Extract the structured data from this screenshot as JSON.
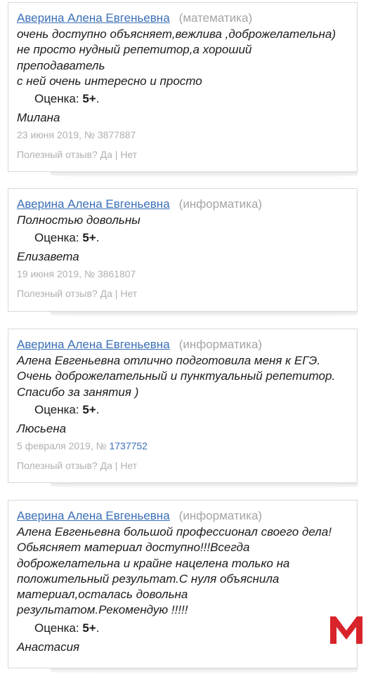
{
  "reviews": [
    {
      "tutor": "Аверина Алена Евгеньевна",
      "subject": "(математика)",
      "lines": [
        "очень доступно объясняет,вежлива ,доброжелательна)",
        "не просто нудный репетитор,а хороший",
        "преподаватель",
        "с ней очень интересно и просто"
      ],
      "rating_label": "Оценка:",
      "rating_value": "5+",
      "author": "Милана",
      "date_prefix": "23 июня 2019, №",
      "number": "3877887",
      "helpful_question": "Полезный отзыв?",
      "yes": "Да",
      "separator": "|",
      "no": "Нет"
    },
    {
      "tutor": "Аверина Алена Евгеньевна",
      "subject": "(информатика)",
      "lines": [
        "Полностью довольны"
      ],
      "rating_label": "Оценка:",
      "rating_value": "5+",
      "author": "Елизавета",
      "date_prefix": "19 июня 2019, №",
      "number": "3861807",
      "helpful_question": "Полезный отзыв?",
      "yes": "Да",
      "separator": "|",
      "no": "Нет"
    },
    {
      "tutor": "Аверина Алена Евгеньевна",
      "subject": "(информатика)",
      "lines": [
        "Алена Евгеньевна отлично подготовила меня к ЕГЭ.",
        "Очень доброжелательный и пунктуальный репетитор.",
        "Спасибо за занятия )"
      ],
      "rating_label": "Оценка:",
      "rating_value": "5+",
      "author": "Люсьена",
      "date_prefix": "5 февраля 2019, №",
      "number": "1737752",
      "helpful_question": "Полезный отзыв?",
      "yes": "Да",
      "separator": "|",
      "no": "Нет"
    },
    {
      "tutor": "Аверина Алена Евгеньевна",
      "subject": "(информатика)",
      "lines": [
        "Алена Евгеньевна большой профессионал своего дела!",
        "Обьясняет материал доступно!!!Всегда",
        "доброжелательна и крайне нацелена только на",
        "положительный результат.С нуля объяснила",
        "материал,осталась довольна",
        "результатом.Рекомендую !!!!!"
      ],
      "rating_label": "Оценка:",
      "rating_value": "5+",
      "author": "Анастасия"
    }
  ],
  "colors": {
    "link": "#3a6fb7",
    "muted": "#a4a4a4",
    "logo_red": "#d8232a"
  },
  "logo_icon": "m-logo-icon"
}
